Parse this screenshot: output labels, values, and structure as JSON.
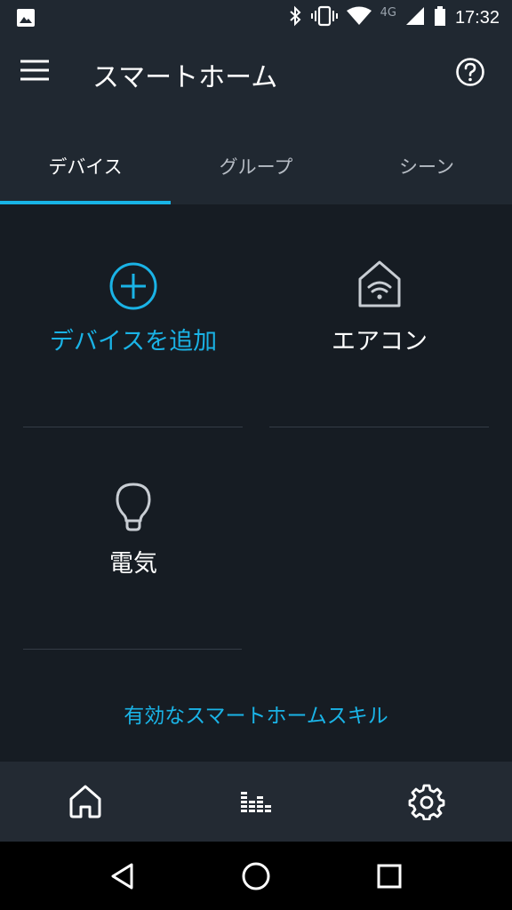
{
  "status_bar": {
    "network": "4G",
    "time": "17:32"
  },
  "app_bar": {
    "title": "スマートホーム"
  },
  "tabs": [
    {
      "label": "デバイス"
    },
    {
      "label": "グループ"
    },
    {
      "label": "シーン"
    }
  ],
  "devices": [
    {
      "label": "デバイスを追加",
      "icon": "add-circle-icon",
      "color": "#1ab3e6"
    },
    {
      "label": "エアコン",
      "icon": "wifi-home-icon",
      "color": "#ffffff"
    },
    {
      "label": "電気",
      "icon": "lightbulb-icon",
      "color": "#ffffff"
    }
  ],
  "skills_link": "有効なスマートホームスキル",
  "bottom_nav": [
    {
      "icon": "home-icon"
    },
    {
      "icon": "equalizer-icon"
    },
    {
      "icon": "gear-icon"
    }
  ],
  "system_nav": [
    {
      "icon": "back-icon"
    },
    {
      "icon": "home-circle-icon"
    },
    {
      "icon": "recents-icon"
    }
  ],
  "colors": {
    "accent": "#1ab3e6",
    "background": "#161c23",
    "header": "#202831"
  }
}
